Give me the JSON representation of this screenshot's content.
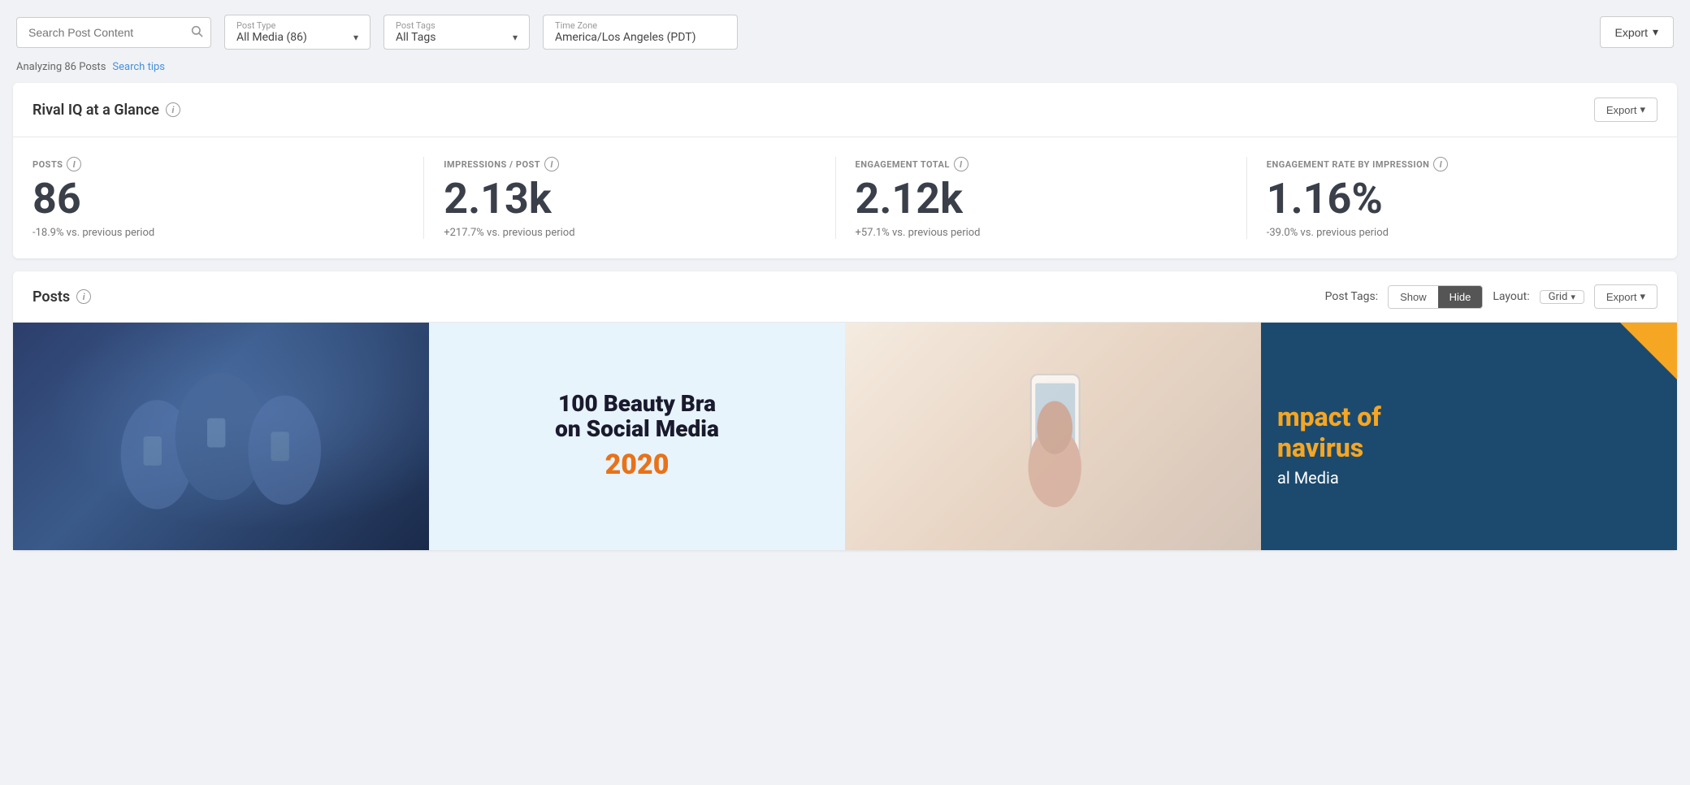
{
  "topbar": {
    "search_placeholder": "Search Post Content",
    "post_type_label": "Post Type",
    "post_type_value": "All Media (86)",
    "post_tags_label": "Post Tags",
    "post_tags_value": "All Tags",
    "timezone_label": "Time Zone",
    "timezone_value": "America/Los Angeles (PDT)",
    "export_label": "Export"
  },
  "subbar": {
    "analyzing_text": "Analyzing 86 Posts",
    "search_tips_label": "Search tips"
  },
  "glance": {
    "title": "Rival IQ at a Glance",
    "export_label": "Export",
    "stats": [
      {
        "label": "POSTS",
        "value": "86",
        "change": "-18.9% vs. previous period"
      },
      {
        "label": "IMPRESSIONS / POST",
        "value": "2.13k",
        "change": "+217.7% vs. previous period"
      },
      {
        "label": "ENGAGEMENT TOTAL",
        "value": "2.12k",
        "change": "+57.1% vs. previous period"
      },
      {
        "label": "ENGAGEMENT RATE BY IMPRESSION",
        "value": "1.16%",
        "change": "-39.0% vs. previous period"
      }
    ]
  },
  "posts_section": {
    "title": "Posts",
    "post_tags_label": "Post Tags:",
    "show_label": "Show",
    "hide_label": "Hide",
    "layout_label": "Layout:",
    "grid_label": "Grid",
    "export_label": "Export",
    "posts": [
      {
        "id": 1,
        "style": "dark-blue-people",
        "alt": "People using phones"
      },
      {
        "id": 2,
        "style": "beauty-brands",
        "alt": "100 Beauty Brands on Social Media 2020",
        "text_line1": "100 Beauty Bra",
        "text_line2": "on Social Media",
        "text_year": "2020"
      },
      {
        "id": 3,
        "style": "phone-hand",
        "alt": "Person holding phone"
      },
      {
        "id": 4,
        "style": "impact-coronavirus",
        "alt": "Impact of Coronavirus on Social Media",
        "text_line1": "mpact of",
        "text_line2": "navirus",
        "text_line3": "al Media"
      }
    ]
  },
  "icons": {
    "search": "🔍",
    "chevron_down": "▾",
    "info": "i",
    "chevron_down_sm": "▾"
  }
}
